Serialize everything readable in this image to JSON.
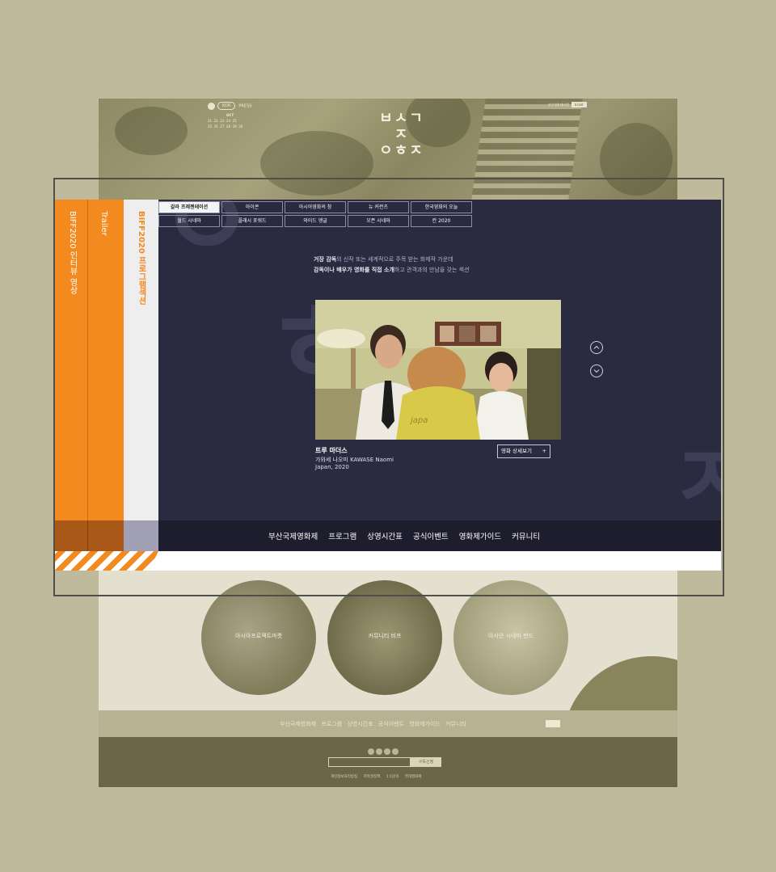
{
  "background_site": {
    "user_menu": {
      "lang": "KOR",
      "press": "PRESS"
    },
    "calendar": {
      "month": "OCT",
      "row1": [
        "21",
        "22",
        "23",
        "24",
        "25"
      ],
      "row2": [
        "25",
        "26",
        "27",
        "28",
        "29",
        "30"
      ]
    },
    "top_right": {
      "link": "부산영화제티켓",
      "tag": "ticket"
    },
    "logo": [
      "ㅂㅅㄱㅈ",
      "ㅇㅎㅈ"
    ],
    "circles": [
      "아시아프로젝트마켓",
      "커뮤니티 비프",
      "아시안 시네마 펀드"
    ],
    "footer_nav": [
      "부산국제영화제",
      "프로그램",
      "상영시간표",
      "공식이벤트",
      "영화제가이드",
      "커뮤니티"
    ],
    "footer": {
      "subscribe_button": "구독신청",
      "links": [
        "개인정보처리방침",
        "저작권정책",
        "1:1문의",
        "역대영화제"
      ]
    }
  },
  "side_tabs": [
    "BIFF2020 인터뷰 영상",
    "Trailer",
    "BIFF2020 프로그램섹션"
  ],
  "program_menu": [
    {
      "label": "갈라 프레젠테이션",
      "active": true
    },
    {
      "label": "아이콘",
      "active": false
    },
    {
      "label": "아시아영화의 창",
      "active": false
    },
    {
      "label": "뉴 커런츠",
      "active": false
    },
    {
      "label": "한국영화의 오늘",
      "active": false
    },
    {
      "label": "월드 시네마",
      "active": false
    },
    {
      "label": "플래시 포워드",
      "active": false
    },
    {
      "label": "와이드 앵글",
      "active": false
    },
    {
      "label": "오픈 시네마",
      "active": false
    },
    {
      "label": "칸 2020",
      "active": false
    }
  ],
  "description": {
    "line1_bold": "거장 감독",
    "line1_rest": "의 신작 또는 세계적으로 주목 받는 화제작 가운데",
    "line2_bold": "감독이나 배우가 영화를 직접 소개",
    "line2_rest": "하고 관객과의 만남을 갖는 섹션"
  },
  "film": {
    "title": "트루 마더스",
    "director": "가와세 나오미 KAWASE Naomi",
    "country_year": "Japan, 2020",
    "detail_button": "영화 상세보기",
    "detail_button_icon": "+",
    "still_caption_text": "japa"
  },
  "bottom_nav": [
    "부산국제영화제",
    "프로그램",
    "상영시간표",
    "공식이벤트",
    "영화제가이드",
    "커뮤니티"
  ],
  "icons": {
    "up": "up-arrow-icon",
    "down": "down-arrow-icon"
  },
  "colors": {
    "accent": "#f28a20",
    "panel_bg": "#2a2a40",
    "nav_bg": "#1e1d2d",
    "bg": "#bfba9b"
  }
}
